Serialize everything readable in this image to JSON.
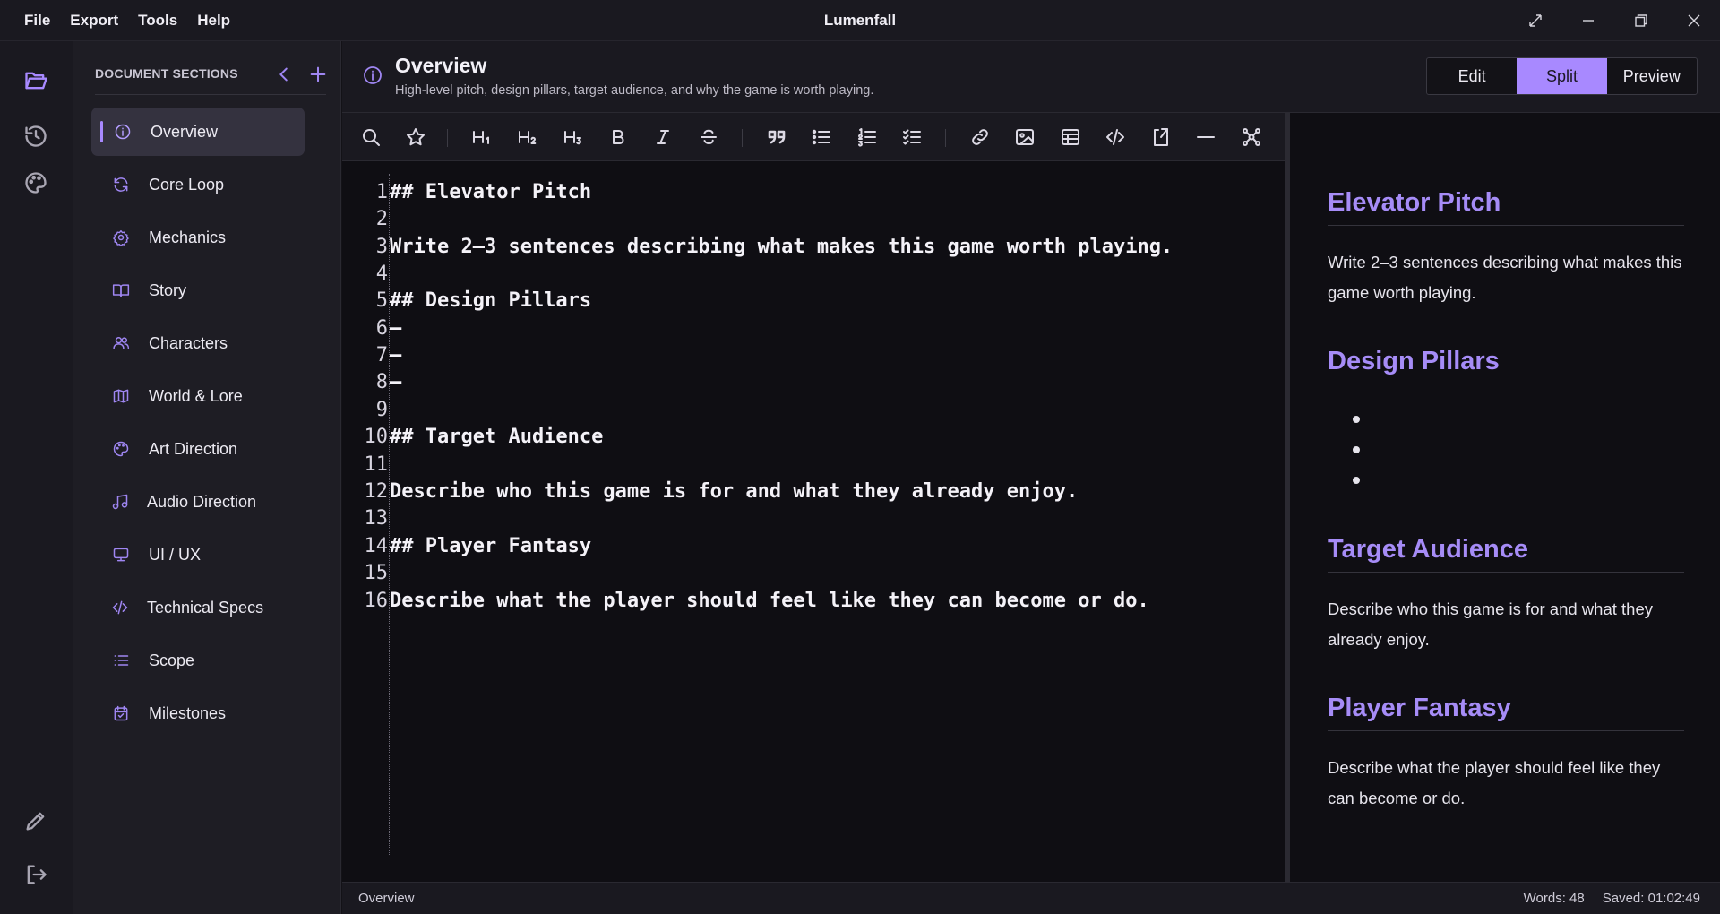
{
  "menu": [
    "File",
    "Export",
    "Tools",
    "Help"
  ],
  "app": {
    "title": "Lumenfall"
  },
  "sidebar": {
    "title": "DOCUMENT SECTIONS",
    "items": [
      {
        "label": "Overview",
        "icon": "info-icon",
        "active": true
      },
      {
        "label": "Core Loop",
        "icon": "refresh-icon"
      },
      {
        "label": "Mechanics",
        "icon": "gear-icon"
      },
      {
        "label": "Story",
        "icon": "book-icon"
      },
      {
        "label": "Characters",
        "icon": "users-icon"
      },
      {
        "label": "World & Lore",
        "icon": "map-icon"
      },
      {
        "label": "Art Direction",
        "icon": "palette-icon"
      },
      {
        "label": "Audio Direction",
        "icon": "music-icon"
      },
      {
        "label": "UI / UX",
        "icon": "monitor-icon"
      },
      {
        "label": "Technical Specs",
        "icon": "code-icon"
      },
      {
        "label": "Scope",
        "icon": "list-icon"
      },
      {
        "label": "Milestones",
        "icon": "calendar-check-icon"
      }
    ]
  },
  "header": {
    "title": "Overview",
    "subtitle": "High-level pitch, design pillars, target audience, and why the game is worth playing.",
    "view_modes": [
      "Edit",
      "Split",
      "Preview"
    ],
    "selected_mode": "Split"
  },
  "editor": {
    "lines": [
      "## Elevator Pitch",
      "",
      "Write 2–3 sentences describing what makes this game worth playing.",
      "",
      "## Design Pillars",
      "–",
      "–",
      "–",
      "",
      "## Target Audience",
      "",
      "Describe who this game is for and what they already enjoy.",
      "",
      "## Player Fantasy",
      "",
      "Describe what the player should feel like they can become or do."
    ]
  },
  "preview": {
    "sections": [
      {
        "heading": "Elevator Pitch",
        "body": "Write 2–3 sentences describing what makes this game worth playing."
      },
      {
        "heading": "Design Pillars",
        "bullets": 3
      },
      {
        "heading": "Target Audience",
        "body": "Describe who this game is for and what they already enjoy."
      },
      {
        "heading": "Player Fantasy",
        "body": "Describe what the player should feel like they can become or do."
      }
    ]
  },
  "status": {
    "section": "Overview",
    "words": "Words: 48",
    "saved": "Saved: 01:02:49"
  },
  "colors": {
    "accent": "#a889ff",
    "heading": "#a68cf7",
    "background": "#0f0e13"
  }
}
